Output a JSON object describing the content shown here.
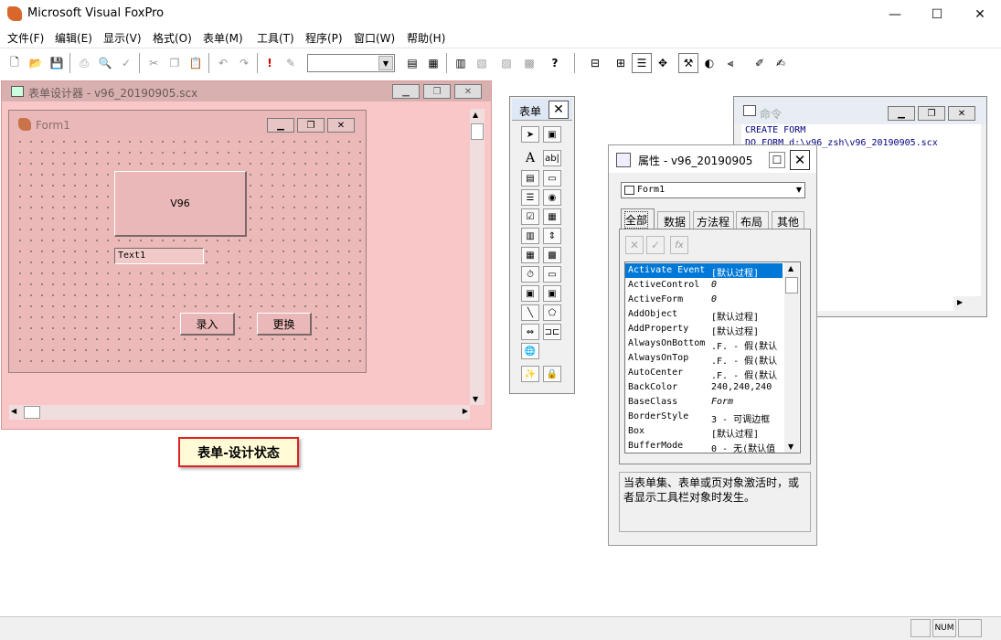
{
  "app": {
    "title": "Microsoft Visual FoxPro",
    "minimize": "—",
    "maximize": "☐",
    "close": "✕"
  },
  "menu": [
    "文件(F)",
    "编辑(E)",
    "显示(V)",
    "格式(O)",
    "表单(M)",
    "工具(T)",
    "程序(P)",
    "窗口(W)",
    "帮助(H)"
  ],
  "toolbar": {
    "combo_value": ""
  },
  "designer": {
    "title": "表单设计器 - v96_20190905.scx",
    "form": {
      "title": "Form1",
      "label_v96": "V96",
      "textbox": "Text1",
      "btn_enter": "录入",
      "btn_change": "更换"
    }
  },
  "annotation": "表单-设计状态",
  "toolbox": {
    "title": "表单"
  },
  "properties": {
    "title": "属性 - v96_20190905",
    "object": "Form1",
    "tabs": [
      "全部",
      "数据",
      "方法程",
      "布局",
      "其他"
    ],
    "rows": [
      {
        "name": "Activate Event",
        "value": "[默认过程]",
        "selected": true
      },
      {
        "name": "ActiveControl",
        "value": "0"
      },
      {
        "name": "ActiveForm",
        "value": "0"
      },
      {
        "name": "AddObject",
        "value": "[默认过程]"
      },
      {
        "name": "AddProperty",
        "value": "[默认过程]"
      },
      {
        "name": "AlwaysOnBottom",
        "value": ".F. - 假(默认"
      },
      {
        "name": "AlwaysOnTop",
        "value": ".F. - 假(默认"
      },
      {
        "name": "AutoCenter",
        "value": ".F. - 假(默认"
      },
      {
        "name": "BackColor",
        "value": "240,240,240"
      },
      {
        "name": "BaseClass",
        "value": "Form"
      },
      {
        "name": "BorderStyle",
        "value": "3 - 可调边框"
      },
      {
        "name": "Box",
        "value": "[默认过程]"
      },
      {
        "name": "BufferMode",
        "value": "0 - 无(默认值"
      }
    ],
    "description": "当表单集、表单或页对象激活时，或者显示工具栏对象时发生。"
  },
  "command": {
    "title": "命令",
    "lines": [
      "CREATE FORM",
      "DO FORM d:\\v96_zsh\\v96_20190905.scx"
    ]
  },
  "status": {
    "num": "NUM"
  }
}
